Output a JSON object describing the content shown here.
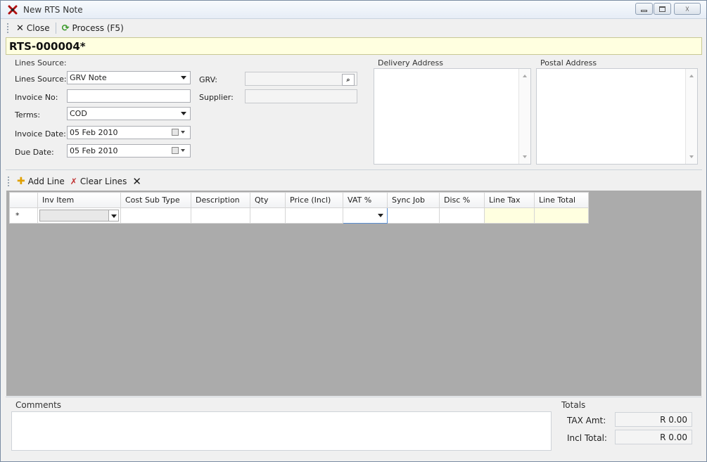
{
  "window": {
    "title": "New RTS Note"
  },
  "toolbar": {
    "close_label": "Close",
    "process_label": "Process (F5)"
  },
  "document": {
    "number": "RTS-000004*"
  },
  "form": {
    "group_label": "Lines Source:",
    "lines_source_label": "Lines Source:",
    "lines_source_value": "GRV Note",
    "invoice_no_label": "Invoice No:",
    "invoice_no_value": "",
    "terms_label": "Terms:",
    "terms_value": "COD",
    "invoice_date_label": "Invoice Date:",
    "invoice_date_value": "05 Feb 2010",
    "due_date_label": "Due Date:",
    "due_date_value": "05 Feb 2010",
    "grv_label": "GRV:",
    "grv_value": "",
    "supplier_label": "Supplier:",
    "supplier_value": ""
  },
  "addresses": {
    "delivery_label": "Delivery Address",
    "postal_label": "Postal Address"
  },
  "lines_toolbar": {
    "add_line_label": "Add Line",
    "clear_lines_label": "Clear Lines"
  },
  "grid": {
    "new_row_marker": "*",
    "columns": [
      "Inv Item",
      "Cost Sub Type",
      "Description",
      "Qty",
      "Price (Incl)",
      "VAT %",
      "Sync Job",
      "Disc %",
      "Line Tax",
      "Line Total"
    ]
  },
  "bottom": {
    "comments_label": "Comments",
    "totals_label": "Totals",
    "tax_amt_label": "TAX Amt:",
    "tax_amt_value": "R 0.00",
    "incl_total_label": "Incl Total:",
    "incl_total_value": "R 0.00"
  },
  "colors": {
    "doc_bar_bg": "#ffffe0",
    "grid_bg": "#ababab",
    "total_cell_bg": "#ffffe0"
  }
}
